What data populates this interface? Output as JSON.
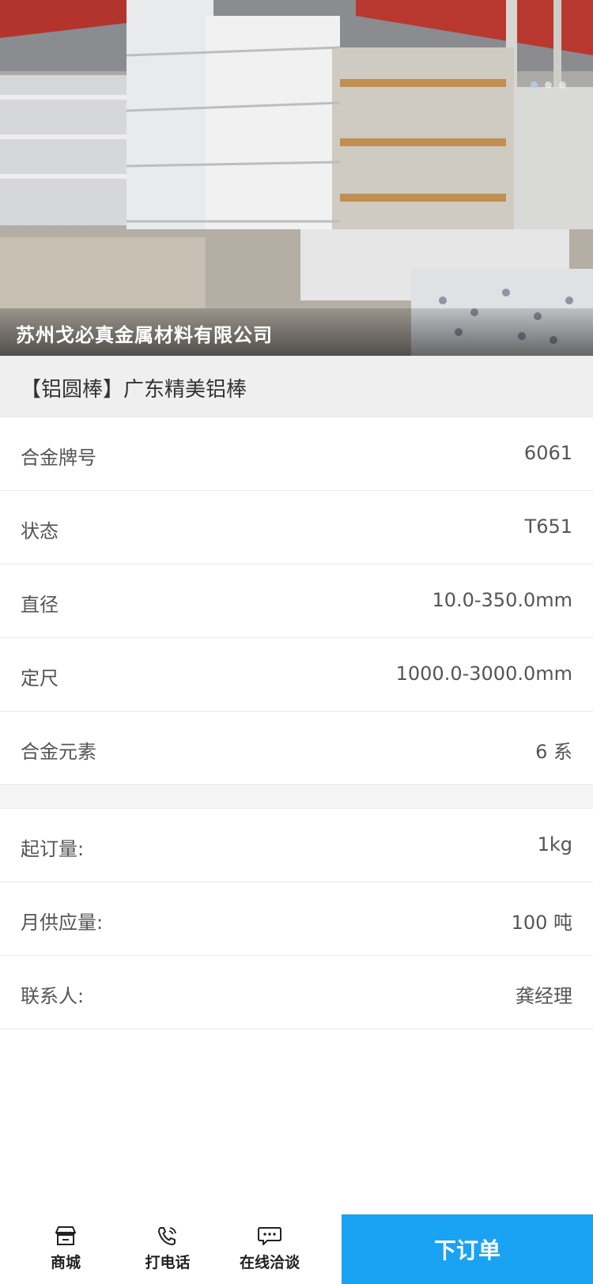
{
  "hero": {
    "company_name": "苏州戈必真金属材料有限公司",
    "carousel_count": 3,
    "carousel_active": 0
  },
  "product": {
    "title": "【铝圆棒】广东精美铝棒"
  },
  "specs": [
    {
      "label": "合金牌号",
      "value": "6061"
    },
    {
      "label": "状态",
      "value": "T651"
    },
    {
      "label": "直径",
      "value": "10.0-350.0mm"
    },
    {
      "label": "定尺",
      "value": "1000.0-3000.0mm"
    },
    {
      "label": "合金元素",
      "value": "6 系"
    }
  ],
  "supply": [
    {
      "label": "起订量:",
      "value": "1kg"
    },
    {
      "label": "月供应量:",
      "value": "100 吨"
    },
    {
      "label": "联系人:",
      "value": "龚经理"
    }
  ],
  "bottom_bar": {
    "tabs": [
      {
        "label": "商城",
        "icon": "store-icon"
      },
      {
        "label": "打电话",
        "icon": "phone-icon"
      },
      {
        "label": "在线洽谈",
        "icon": "chat-icon"
      }
    ],
    "order_button": "下订单",
    "accent_color": "#1aa3f2"
  }
}
